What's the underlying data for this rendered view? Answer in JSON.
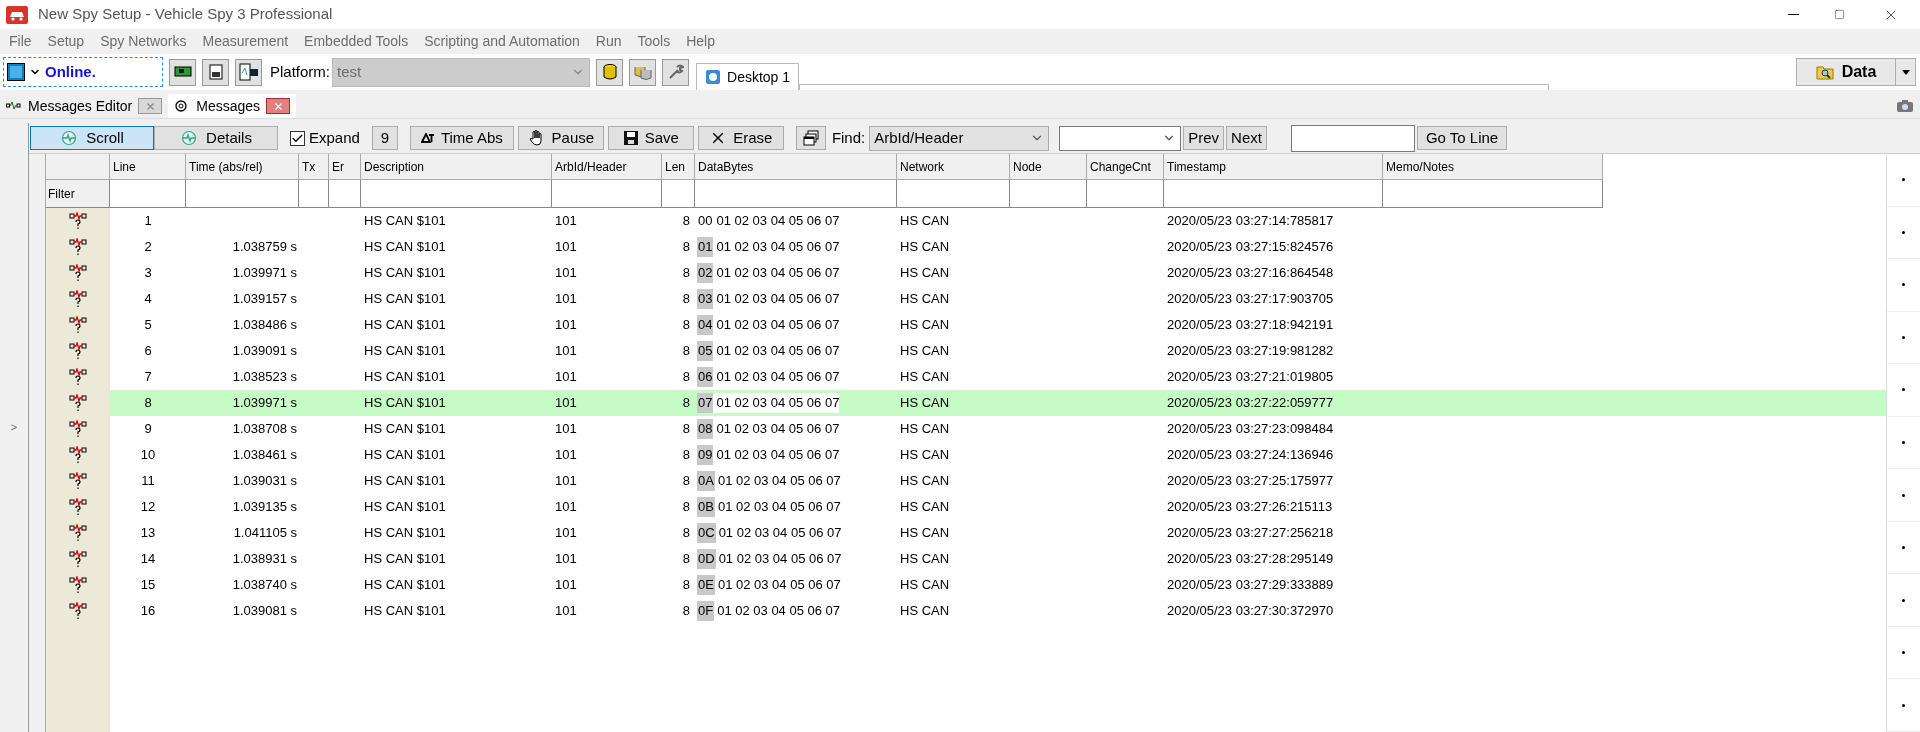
{
  "window": {
    "title": "New Spy Setup - Vehicle Spy 3 Professional"
  },
  "menu": [
    "File",
    "Setup",
    "Spy Networks",
    "Measurement",
    "Embedded Tools",
    "Scripting and Automation",
    "Run",
    "Tools",
    "Help"
  ],
  "toolbar": {
    "status": "Online.",
    "platform_label": "Platform:",
    "platform_value": "test",
    "desktop_tab": "Desktop 1",
    "data_button": "Data"
  },
  "doc_tabs": [
    {
      "label": "Messages Editor",
      "selected": false
    },
    {
      "label": "Messages",
      "selected": true
    }
  ],
  "view_buttons": [
    {
      "kind": "toggle",
      "label": "Scroll",
      "selected": true
    },
    {
      "kind": "toggle",
      "label": "Details",
      "selected": false
    },
    {
      "kind": "check",
      "label": "Expand",
      "checked": true
    },
    {
      "kind": "plain",
      "label": "9"
    },
    {
      "kind": "plain",
      "label": "Time Abs"
    },
    {
      "kind": "plain",
      "label": "Pause"
    },
    {
      "kind": "plain",
      "label": "Save"
    },
    {
      "kind": "plain",
      "label": "Erase"
    },
    {
      "kind": "plain"
    }
  ],
  "find": {
    "label": "Find:",
    "field": "ArbId/Header",
    "prev": "Prev",
    "next": "Next",
    "goto": "Go To Line"
  },
  "table": {
    "filter_label": "Filter",
    "columns": [
      "Line",
      "Time (abs/rel)",
      "Tx",
      "Er",
      "Description",
      "ArbId/Header",
      "Len",
      "DataBytes",
      "Network",
      "Node",
      "ChangeCnt",
      "Timestamp",
      "Memo/Notes"
    ],
    "rows": [
      {
        "line": "1",
        "description": "HS CAN $101",
        "arbid": "101",
        "len": "8",
        "first_byte": "00",
        "changed": false,
        "bytes": "01 02 03 04 05 06 07",
        "network": "HS CAN",
        "timestamp": "2020/05/23 03:27:14:785817",
        "selected": false
      },
      {
        "line": "2",
        "time": "1.038759 s",
        "description": "HS CAN $101",
        "arbid": "101",
        "len": "8",
        "first_byte": "01",
        "changed": true,
        "bytes": "01 02 03 04 05 06 07",
        "network": "HS CAN",
        "timestamp": "2020/05/23 03:27:15:824576",
        "selected": false
      },
      {
        "line": "3",
        "time": "1.039971 s",
        "description": "HS CAN $101",
        "arbid": "101",
        "len": "8",
        "first_byte": "02",
        "changed": true,
        "bytes": "01 02 03 04 05 06 07",
        "network": "HS CAN",
        "timestamp": "2020/05/23 03:27:16:864548",
        "selected": false
      },
      {
        "line": "4",
        "time": "1.039157 s",
        "description": "HS CAN $101",
        "arbid": "101",
        "len": "8",
        "first_byte": "03",
        "changed": true,
        "bytes": "01 02 03 04 05 06 07",
        "network": "HS CAN",
        "timestamp": "2020/05/23 03:27:17:903705",
        "selected": false
      },
      {
        "line": "5",
        "time": "1.038486 s",
        "description": "HS CAN $101",
        "arbid": "101",
        "len": "8",
        "first_byte": "04",
        "changed": true,
        "bytes": "01 02 03 04 05 06 07",
        "network": "HS CAN",
        "timestamp": "2020/05/23 03:27:18:942191",
        "selected": false
      },
      {
        "line": "6",
        "time": "1.039091 s",
        "description": "HS CAN $101",
        "arbid": "101",
        "len": "8",
        "first_byte": "05",
        "changed": true,
        "bytes": "01 02 03 04 05 06 07",
        "network": "HS CAN",
        "timestamp": "2020/05/23 03:27:19:981282",
        "selected": false
      },
      {
        "line": "7",
        "time": "1.038523 s",
        "description": "HS CAN $101",
        "arbid": "101",
        "len": "8",
        "first_byte": "06",
        "changed": true,
        "bytes": "01 02 03 04 05 06 07",
        "network": "HS CAN",
        "timestamp": "2020/05/23 03:27:21:019805",
        "selected": false
      },
      {
        "line": "8",
        "time": "1.039971 s",
        "description": "HS CAN $101",
        "arbid": "101",
        "len": "8",
        "first_byte": "07",
        "changed": true,
        "bytes": "01 02 03 04 05 06 07",
        "network": "HS CAN",
        "timestamp": "2020/05/23 03:27:22:059777",
        "selected": true
      },
      {
        "line": "9",
        "time": "1.038708 s",
        "description": "HS CAN $101",
        "arbid": "101",
        "len": "8",
        "first_byte": "08",
        "changed": true,
        "bytes": "01 02 03 04 05 06 07",
        "network": "HS CAN",
        "timestamp": "2020/05/23 03:27:23:098484",
        "selected": false
      },
      {
        "line": "10",
        "time": "1.038461 s",
        "description": "HS CAN $101",
        "arbid": "101",
        "len": "8",
        "first_byte": "09",
        "changed": true,
        "bytes": "01 02 03 04 05 06 07",
        "network": "HS CAN",
        "timestamp": "2020/05/23 03:27:24:136946",
        "selected": false
      },
      {
        "line": "11",
        "time": "1.039031 s",
        "description": "HS CAN $101",
        "arbid": "101",
        "len": "8",
        "first_byte": "0A",
        "changed": true,
        "bytes": "01 02 03 04 05 06 07",
        "network": "HS CAN",
        "timestamp": "2020/05/23 03:27:25:175977",
        "selected": false
      },
      {
        "line": "12",
        "time": "1.039135 s",
        "description": "HS CAN $101",
        "arbid": "101",
        "len": "8",
        "first_byte": "0B",
        "changed": true,
        "bytes": "01 02 03 04 05 06 07",
        "network": "HS CAN",
        "timestamp": "2020/05/23 03:27:26:215113",
        "selected": false
      },
      {
        "line": "13",
        "time": "1.041105 s",
        "description": "HS CAN $101",
        "arbid": "101",
        "len": "8",
        "first_byte": "0C",
        "changed": true,
        "bytes": "01 02 03 04 05 06 07",
        "network": "HS CAN",
        "timestamp": "2020/05/23 03:27:27:256218",
        "selected": false
      },
      {
        "line": "14",
        "time": "1.038931 s",
        "description": "HS CAN $101",
        "arbid": "101",
        "len": "8",
        "first_byte": "0D",
        "changed": true,
        "bytes": "01 02 03 04 05 06 07",
        "network": "HS CAN",
        "timestamp": "2020/05/23 03:27:28:295149",
        "selected": false
      },
      {
        "line": "15",
        "time": "1.038740 s",
        "description": "HS CAN $101",
        "arbid": "101",
        "len": "8",
        "first_byte": "0E",
        "changed": true,
        "bytes": "01 02 03 04 05 06 07",
        "network": "HS CAN",
        "timestamp": "2020/05/23 03:27:29:333889",
        "selected": false
      },
      {
        "line": "16",
        "time": "1.039081 s",
        "description": "HS CAN $101",
        "arbid": "101",
        "len": "8",
        "first_byte": "0F",
        "changed": true,
        "bytes": "01 02 03 04 05 06 07",
        "network": "HS CAN",
        "timestamp": "2020/05/23 03:27:30:372970",
        "selected": false
      }
    ]
  },
  "side": {
    "expander": ">"
  }
}
